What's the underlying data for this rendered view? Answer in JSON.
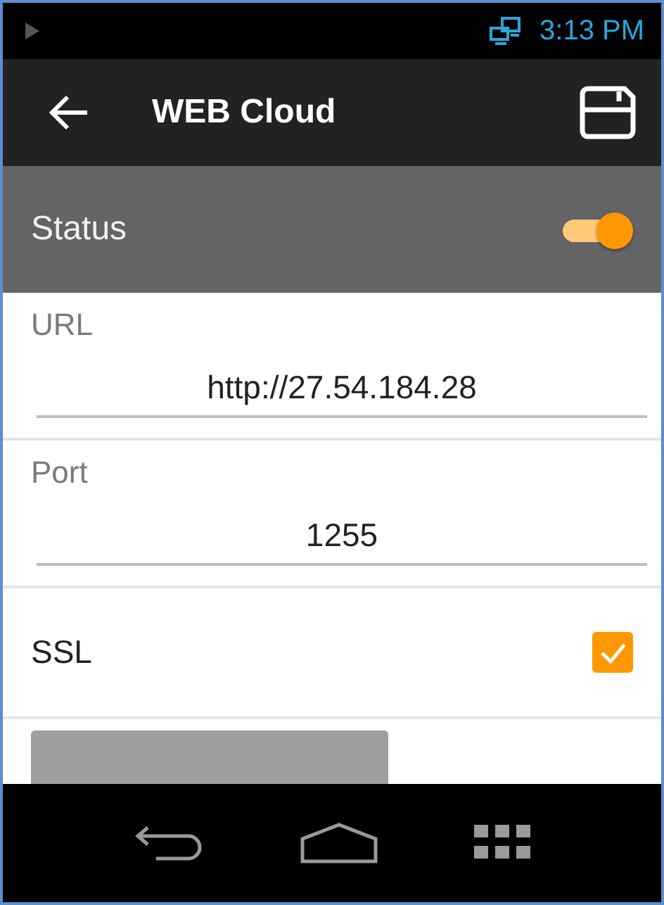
{
  "status_bar": {
    "time": "3:13 PM"
  },
  "app_bar": {
    "title": "WEB Cloud"
  },
  "status_row": {
    "label": "Status",
    "on": true
  },
  "fields": [
    {
      "label": "URL",
      "value": "http://27.54.184.28"
    },
    {
      "label": "Port",
      "value": "1255"
    }
  ],
  "ssl": {
    "label": "SSL",
    "checked": true
  },
  "test_button": {
    "disabled": true
  }
}
